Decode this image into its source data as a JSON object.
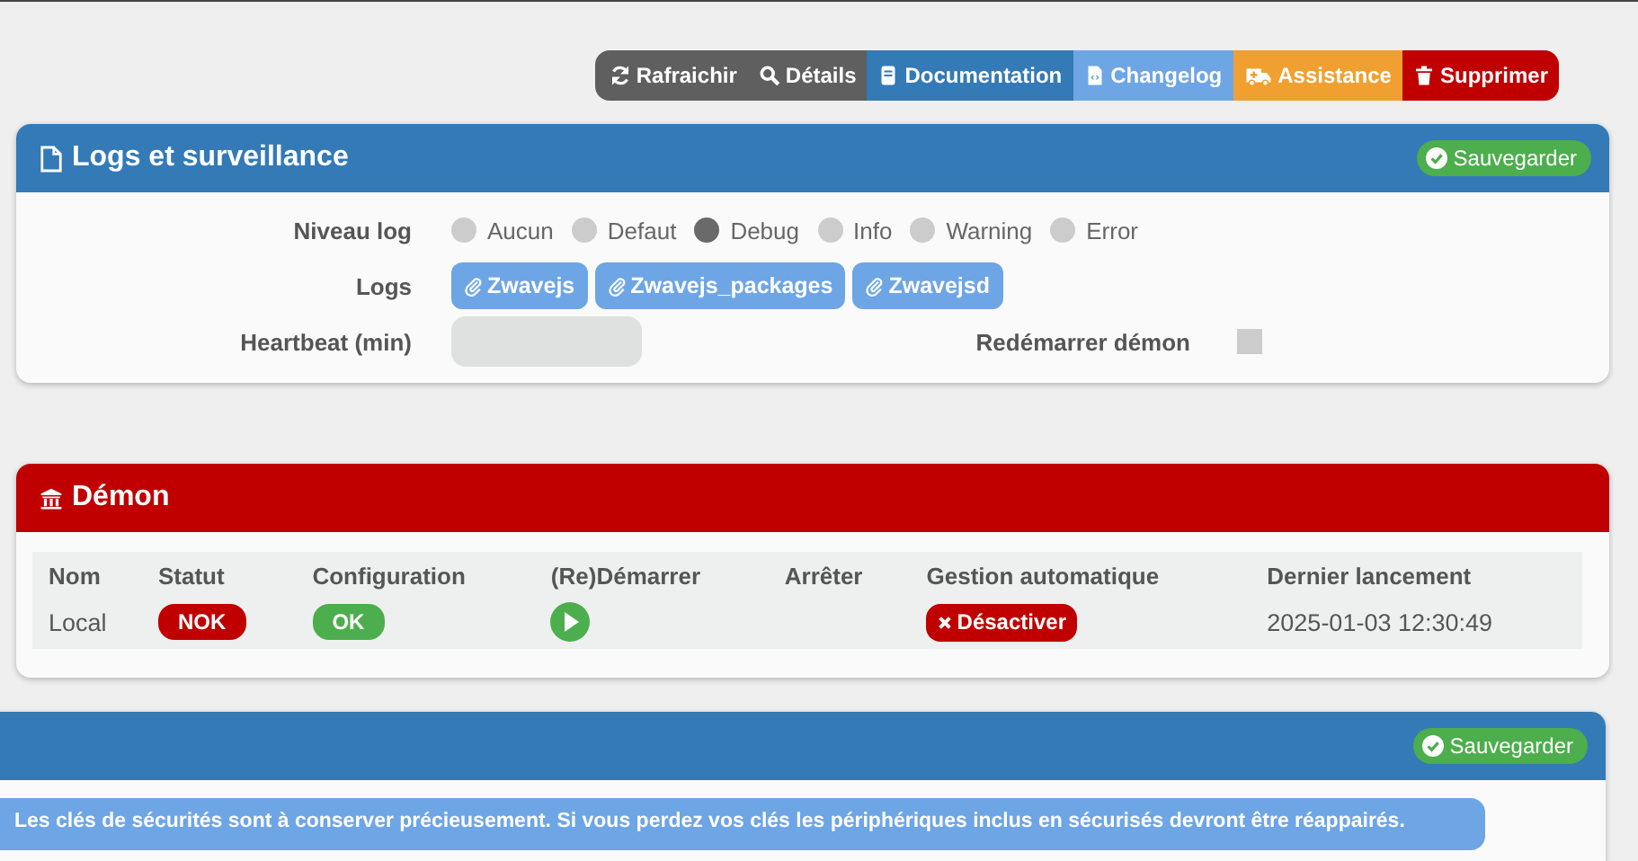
{
  "toolbar": [
    {
      "label": "Rafraichir",
      "kind": "default"
    },
    {
      "label": "Détails",
      "kind": "default"
    },
    {
      "label": "Documentation",
      "kind": "primary"
    },
    {
      "label": "Changelog",
      "kind": "info"
    },
    {
      "label": "Assistance",
      "kind": "warning"
    },
    {
      "label": "Supprimer",
      "kind": "danger"
    }
  ],
  "logs_panel": {
    "title": "Logs et surveillance",
    "save_button": "Sauvegarder",
    "log_level": {
      "label": "Niveau log",
      "options": [
        {
          "label": "Aucun",
          "selected": false
        },
        {
          "label": "Defaut",
          "selected": false
        },
        {
          "label": "Debug",
          "selected": true
        },
        {
          "label": "Info",
          "selected": false
        },
        {
          "label": "Warning",
          "selected": false
        },
        {
          "label": "Error",
          "selected": false
        }
      ]
    },
    "logs": {
      "label": "Logs",
      "buttons": [
        "Zwavejs",
        "Zwavejs_packages",
        "Zwavejsd"
      ]
    },
    "heartbeat": {
      "label": "Heartbeat (min)"
    },
    "restart_daemon": {
      "label": "Redémarrer démon",
      "checked": false
    }
  },
  "daemon_panel": {
    "title": "Démon",
    "columns": [
      "Nom",
      "Statut",
      "Configuration",
      "(Re)Démarrer",
      "Arrêter",
      "Gestion automatique",
      "Dernier lancement"
    ],
    "row": {
      "name": "Local",
      "status": {
        "label": "NOK",
        "kind": "danger"
      },
      "configuration": {
        "label": "OK",
        "kind": "success"
      },
      "auto_button": "Désactiver",
      "last_launch": "2025-01-03 12:30:49"
    }
  },
  "keys_panel": {
    "save_button": "Sauvegarder",
    "alert": "Les clés de sécurités sont à conserver précieusement. Si vous perdez vos clés les périphériques inclus en sécurisés devront être réappairés."
  }
}
